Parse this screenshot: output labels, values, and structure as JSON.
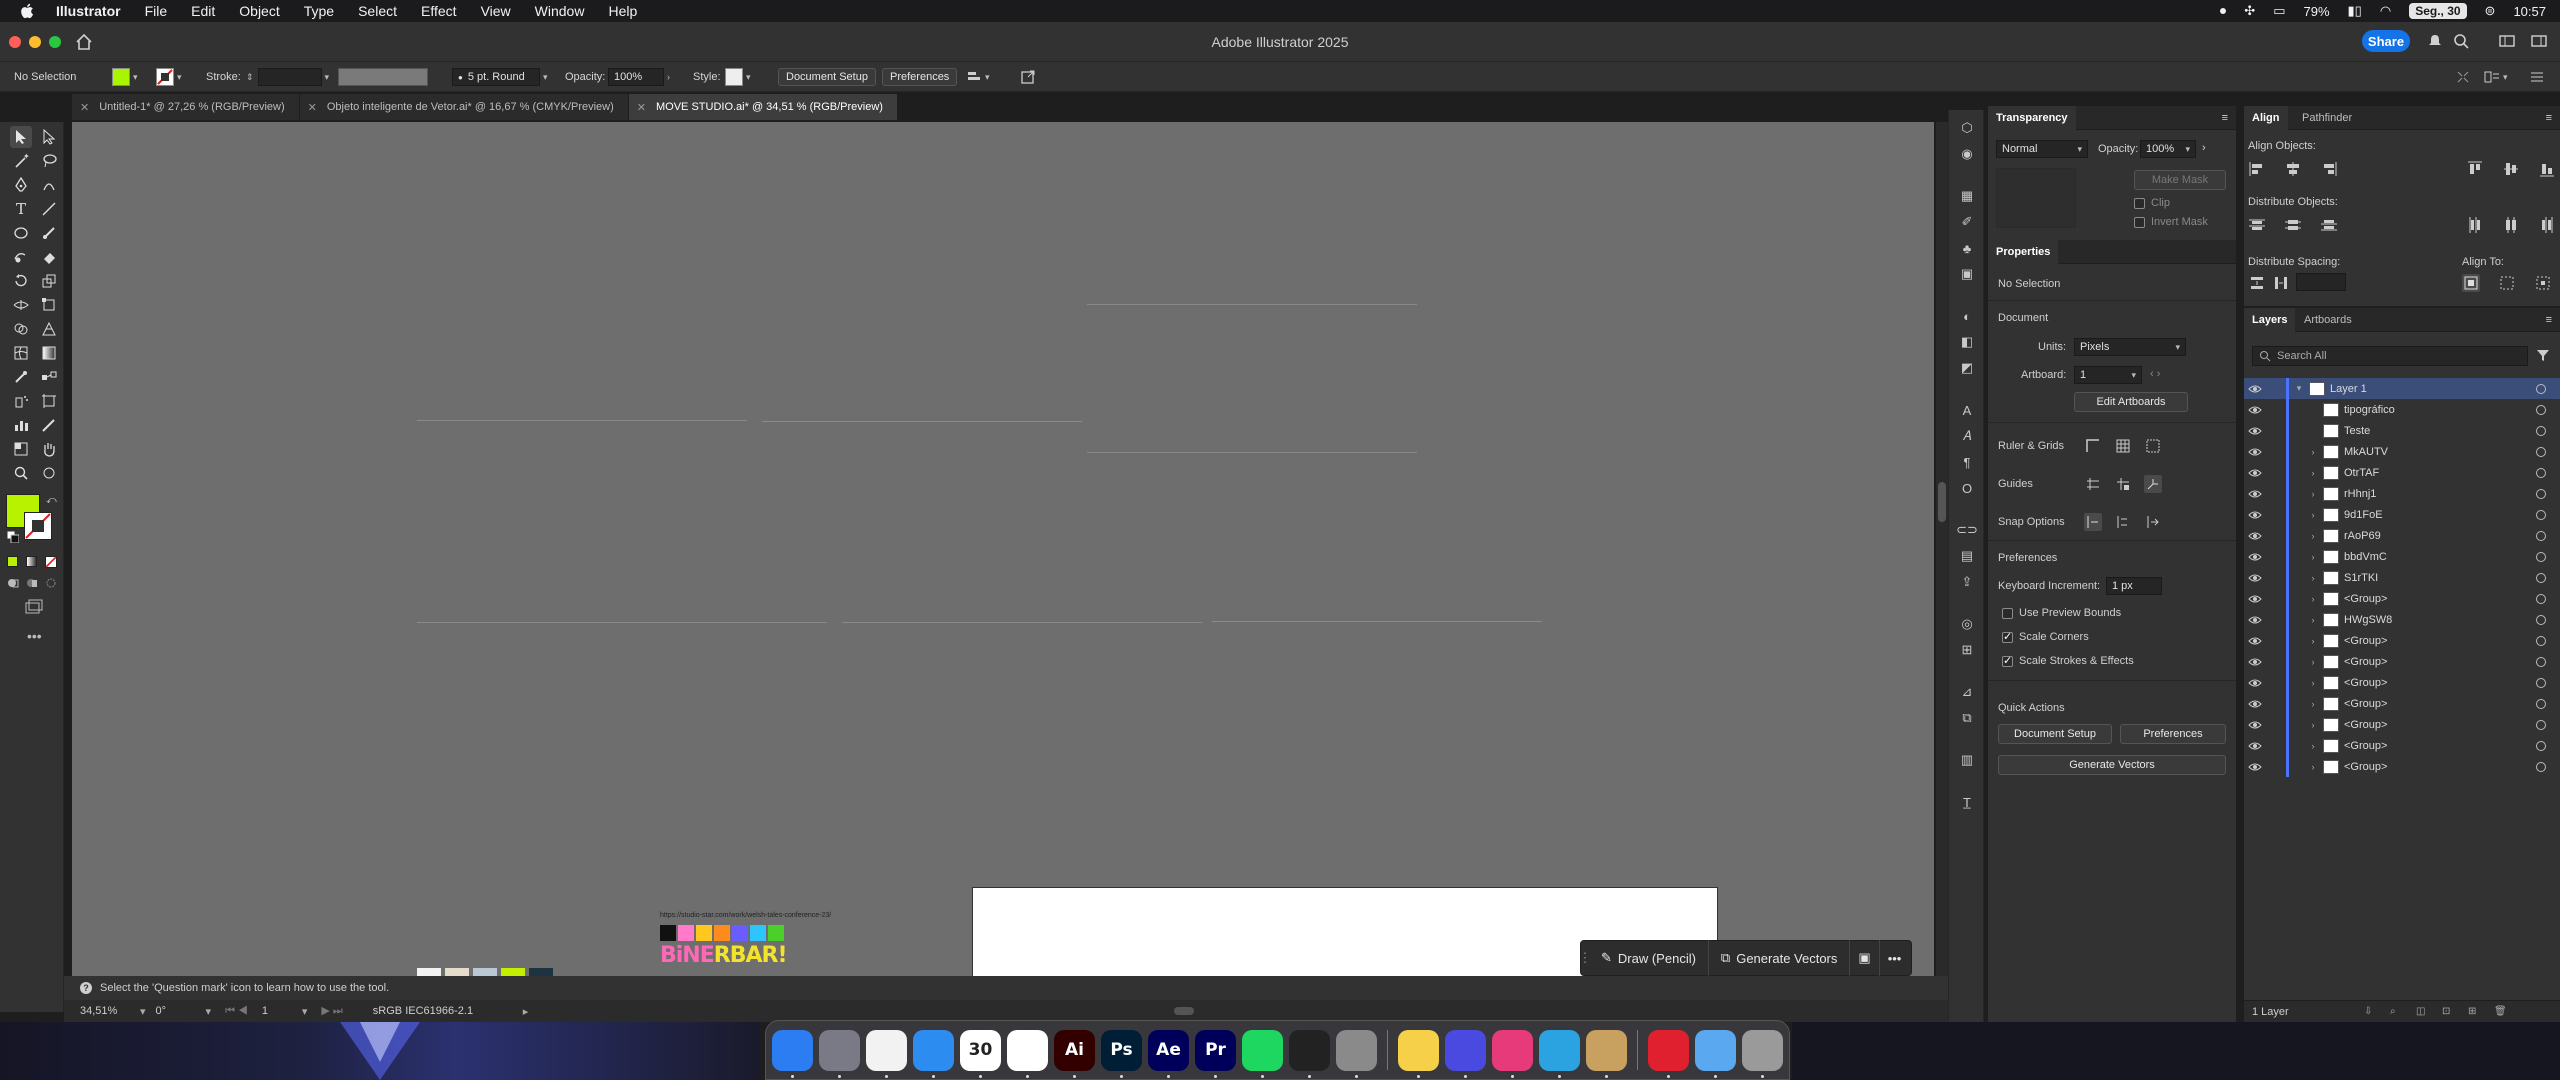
{
  "menubar": {
    "app": "Illustrator",
    "items": [
      "File",
      "Edit",
      "Object",
      "Type",
      "Select",
      "Effect",
      "View",
      "Window",
      "Help"
    ],
    "battery": "79%",
    "date": "Seg., 30",
    "time": "10:57"
  },
  "window": {
    "title": "Adobe Illustrator 2025",
    "share_label": "Share"
  },
  "controlbar": {
    "selection": "No Selection",
    "fill_color": "#a8f500",
    "stroke_label": "Stroke:",
    "brush": "5 pt. Round",
    "opacity_label": "Opacity:",
    "opacity_value": "100%",
    "style_label": "Style:",
    "document_setup": "Document Setup",
    "preferences": "Preferences"
  },
  "tabs": [
    {
      "label": "Untitled-1* @ 27,26 % (RGB/Preview)",
      "active": false
    },
    {
      "label": "Objeto inteligente de Vetor.ai* @ 16,67 % (CMYK/Preview)",
      "active": false
    },
    {
      "label": "MOVE STUDIO.ai* @ 34,51 % (RGB/Preview)",
      "active": true
    }
  ],
  "canvas": {
    "preview_url": "https://studio-star.com/work/welsh-tales-conference-23/",
    "preview_logo_a": "BiNE",
    "preview_logo_b": "R",
    "preview_logo_c": "BAR!",
    "chip_colors": [
      "#111111",
      "#ff7ac8",
      "#ffc81e",
      "#ff8a1e",
      "#6a5cff",
      "#2ec5ff",
      "#4ccf2b"
    ]
  },
  "context_bar": {
    "draw_label": "Draw (Pencil)",
    "generate_label": "Generate Vectors"
  },
  "helpbar": {
    "text": "Select the 'Question mark' icon to learn how to use the tool."
  },
  "statusbar": {
    "zoom": "34,51%",
    "rotation": "0°",
    "artboard": "1",
    "profile": "sRGB IEC61966-2.1"
  },
  "transparency": {
    "tab": "Transparency",
    "blend_mode": "Normal",
    "opacity_label": "Opacity:",
    "opacity_value": "100%",
    "make_mask": "Make Mask",
    "clip": "Clip",
    "invert_mask": "Invert Mask"
  },
  "properties": {
    "tab": "Properties",
    "no_selection": "No Selection",
    "document": "Document",
    "units_label": "Units:",
    "units_value": "Pixels",
    "artboard_label": "Artboard:",
    "artboard_value": "1",
    "edit_artboards": "Edit Artboards",
    "ruler_grids": "Ruler & Grids",
    "guides": "Guides",
    "snap_options": "Snap Options",
    "preferences": "Preferences",
    "keyboard_increment_label": "Keyboard Increment:",
    "keyboard_increment_value": "1 px",
    "use_preview_bounds": "Use Preview Bounds",
    "scale_corners": "Scale Corners",
    "scale_strokes": "Scale Strokes & Effects",
    "quick_actions": "Quick Actions",
    "document_setup": "Document Setup",
    "preferences_btn": "Preferences",
    "generate_vectors": "Generate Vectors"
  },
  "align": {
    "tab_align": "Align",
    "tab_pathfinder": "Pathfinder",
    "align_objects": "Align Objects:",
    "distribute_objects": "Distribute Objects:",
    "distribute_spacing": "Distribute Spacing:",
    "align_to": "Align To:"
  },
  "layers": {
    "tab_layers": "Layers",
    "tab_artboards": "Artboards",
    "search_placeholder": "Search All",
    "footer": "1 Layer",
    "rows": [
      {
        "name": "Layer 1",
        "top": true
      },
      {
        "name": "tipográfico"
      },
      {
        "name": "Teste"
      },
      {
        "name": "MkAUTV"
      },
      {
        "name": "OtrTAF"
      },
      {
        "name": "rHhnj1"
      },
      {
        "name": "9d1FoE"
      },
      {
        "name": "rAoP69"
      },
      {
        "name": "bbdVmC"
      },
      {
        "name": "S1rTKI"
      },
      {
        "name": "<Group>"
      },
      {
        "name": "HWgSW8"
      },
      {
        "name": "<Group>"
      },
      {
        "name": "<Group>"
      },
      {
        "name": "<Group>"
      },
      {
        "name": "<Group>"
      },
      {
        "name": "<Group>"
      },
      {
        "name": "<Group>"
      },
      {
        "name": "<Group>"
      }
    ]
  },
  "dock": {
    "apps": [
      {
        "name": "finder-app",
        "label": "",
        "color": "#2c7cf2"
      },
      {
        "name": "launchpad-app",
        "label": "",
        "color": "#7a7a86"
      },
      {
        "name": "chrome-app",
        "label": "",
        "color": "#f2f2f2"
      },
      {
        "name": "mail-app",
        "label": "",
        "color": "#2c8cf0"
      },
      {
        "name": "calendar-app",
        "label": "30",
        "color": "#ffffff"
      },
      {
        "name": "freeform-app",
        "label": "",
        "color": "#ffffff"
      },
      {
        "name": "illustrator-app",
        "label": "Ai",
        "color": "#330000"
      },
      {
        "name": "photoshop-app",
        "label": "Ps",
        "color": "#001e36"
      },
      {
        "name": "after-effects-app",
        "label": "Ae",
        "color": "#00005b"
      },
      {
        "name": "premiere-app",
        "label": "Pr",
        "color": "#00005b"
      },
      {
        "name": "spotify-app",
        "label": "",
        "color": "#1ed760"
      },
      {
        "name": "activity-monitor-app",
        "label": "",
        "color": "#222"
      },
      {
        "name": "settings-app",
        "label": "",
        "color": "#8a8a8a"
      },
      {
        "name": "notes-app",
        "label": "",
        "color": "#f7d04a"
      },
      {
        "name": "creative-cloud-app",
        "label": "",
        "color": "#4a4ae0"
      },
      {
        "name": "cc-libraries-app",
        "label": "",
        "color": "#e63a7a"
      },
      {
        "name": "telegram-app",
        "label": "",
        "color": "#2aa3e0"
      },
      {
        "name": "archive-app",
        "label": "",
        "color": "#c8a060"
      },
      {
        "name": "opera-app",
        "label": "",
        "color": "#e0202e"
      },
      {
        "name": "downloads-folder",
        "label": "",
        "color": "#5aa8f0"
      },
      {
        "name": "trash-app",
        "label": "",
        "color": "#9a9a9a"
      }
    ]
  }
}
